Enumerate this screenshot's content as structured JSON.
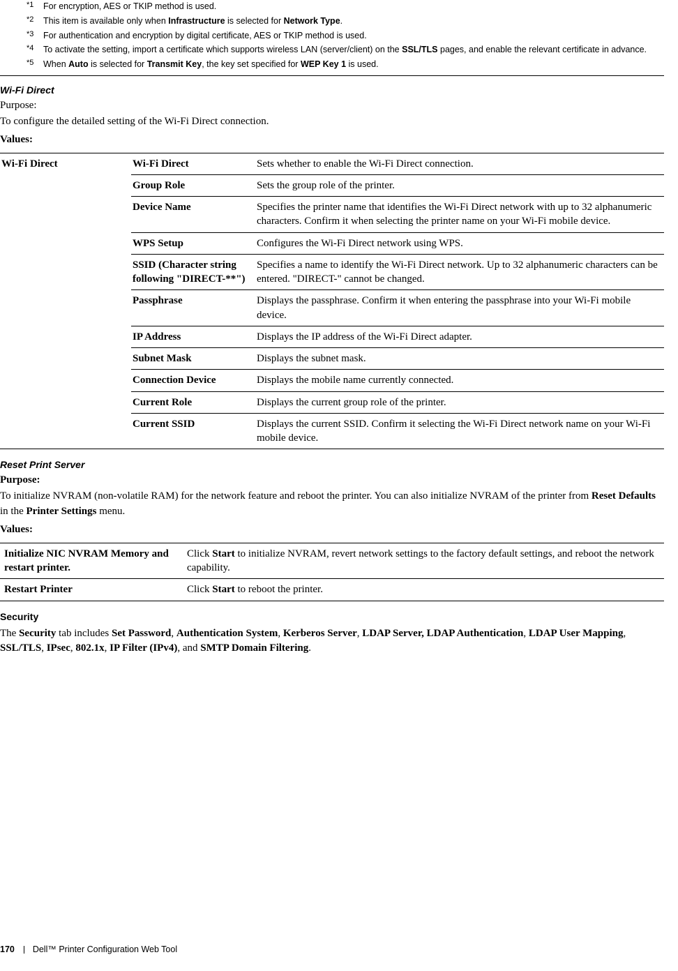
{
  "footnotes": [
    {
      "marker": "*1",
      "text": "For encryption, AES or TKIP method is used."
    },
    {
      "marker": "*2",
      "parts": [
        "This item is available only when ",
        {
          "b": "Infrastructure"
        },
        " is selected for ",
        {
          "b": "Network Type"
        },
        "."
      ]
    },
    {
      "marker": "*3",
      "text": "For authentication and encryption by digital certificate, AES or TKIP method is used."
    },
    {
      "marker": "*4",
      "parts": [
        "To activate the setting, import a certificate which supports wireless LAN (server/client) on the ",
        {
          "b": "SSL/TLS"
        },
        " pages, and enable the relevant certificate in advance."
      ]
    },
    {
      "marker": "*5",
      "parts": [
        "When ",
        {
          "b": "Auto"
        },
        " is selected for ",
        {
          "b": "Transmit Key"
        },
        ", the key set specified for ",
        {
          "b": "WEP Key 1"
        },
        " is used."
      ]
    }
  ],
  "wifi_direct": {
    "heading": "Wi-Fi Direct",
    "purpose_label": "Purpose:",
    "purpose_text": "To configure the detailed setting of the Wi-Fi Direct connection.",
    "values_label": "Values:",
    "category": "Wi-Fi Direct",
    "rows": [
      {
        "name": "Wi-Fi Direct",
        "desc": "Sets whether to enable the Wi-Fi Direct connection."
      },
      {
        "name": "Group Role",
        "desc": "Sets the group role of the printer."
      },
      {
        "name": "Device Name",
        "desc": "Specifies the printer name that identifies the Wi-Fi Direct network with up to 32 alphanumeric characters. Confirm it when selecting the printer name on your Wi-Fi mobile device."
      },
      {
        "name": "WPS Setup",
        "desc": "Configures the Wi-Fi Direct network using WPS."
      },
      {
        "name": "SSID (Character string following \"DIRECT-**\")",
        "desc": "Specifies a name to identify the Wi-Fi Direct network. Up to 32 alphanumeric characters can be entered. \"DIRECT-\" cannot be changed."
      },
      {
        "name": "Passphrase",
        "desc": "Displays the passphrase. Confirm it when entering the passphrase into your Wi-Fi mobile device."
      },
      {
        "name": "IP Address",
        "desc": "Displays the IP address of the Wi-Fi Direct adapter."
      },
      {
        "name": "Subnet Mask",
        "desc": "Displays the subnet mask."
      },
      {
        "name": "Connection Device",
        "desc": "Displays the mobile name currently connected."
      },
      {
        "name": "Current Role",
        "desc": "Displays the current group role of the printer."
      },
      {
        "name": "Current SSID",
        "desc": "Displays the current SSID. Confirm it selecting the Wi-Fi Direct network name on your Wi-Fi mobile device."
      }
    ]
  },
  "reset_print_server": {
    "heading": "Reset Print Server",
    "purpose_label": "Purpose:",
    "purpose_parts": [
      "To initialize NVRAM (non-volatile RAM) for the network feature and reboot the printer. You can also initialize NVRAM of the printer from ",
      {
        "b": "Reset Defaults"
      },
      " in the ",
      {
        "b": "Printer Settings"
      },
      " menu."
    ],
    "values_label": "Values:",
    "rows": [
      {
        "name": "Initialize NIC NVRAM Memory and restart printer.",
        "desc_parts": [
          "Click ",
          {
            "b": "Start"
          },
          " to initialize NVRAM, revert network settings to the factory default settings, and reboot the network capability."
        ]
      },
      {
        "name": "Restart Printer",
        "desc_parts": [
          "Click ",
          {
            "b": "Start"
          },
          " to reboot the printer."
        ]
      }
    ]
  },
  "security": {
    "heading": "Security",
    "parts": [
      "The ",
      {
        "b": "Security"
      },
      " tab includes ",
      {
        "b": "Set Password"
      },
      ", ",
      {
        "b": "Authentication System"
      },
      ", ",
      {
        "b": "Kerberos Server"
      },
      ", ",
      {
        "b": "LDAP Server, LDAP Authentication"
      },
      ", ",
      {
        "b": "LDAP User Mapping"
      },
      ", ",
      {
        "b": "SSL/TLS"
      },
      ", ",
      {
        "b": "IPsec"
      },
      ", ",
      {
        "b": "802.1x"
      },
      ", ",
      {
        "b": "IP Filter (IPv4)"
      },
      ", and ",
      {
        "b": "SMTP Domain Filtering"
      },
      "."
    ]
  },
  "footer": {
    "page": "170",
    "doc": "Dell™ Printer Configuration Web Tool"
  }
}
